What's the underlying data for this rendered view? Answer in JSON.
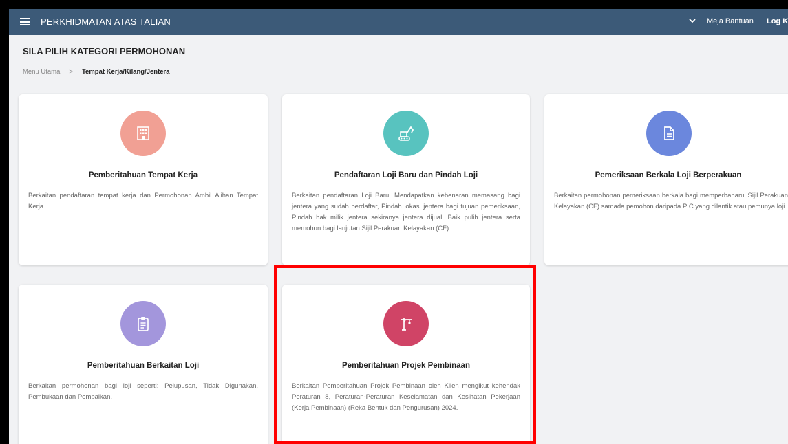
{
  "header": {
    "title": "PERKHIDMATAN ATAS TALIAN",
    "help_label": "Meja Bantuan",
    "logout_label": "Log Ke"
  },
  "page": {
    "title": "SILA PILIH KATEGORI PERMOHONAN",
    "breadcrumb": {
      "home": "Menu Utama",
      "separator": ">",
      "current": "Tempat Kerja/Kilang/Jentera"
    }
  },
  "cards": [
    {
      "title": "Pemberitahuan Tempat Kerja",
      "description": "Berkaitan pendaftaran tempat kerja dan Permohonan Ambil Alihan Tempat Kerja",
      "icon": "building-icon",
      "color": "#f1a094"
    },
    {
      "title": "Pendaftaran Loji Baru dan Pindah Loji",
      "description": "Berkaitan pendaftaran Loji Baru, Mendapatkan kebenaran memasang bagi jentera yang sudah berdaftar, Pindah lokasi jentera bagi tujuan pemeriksaan, Pindah hak milik jentera sekiranya jentera dijual, Baik pulih jentera serta memohon bagi lanjutan Sijil Perakuan Kelayakan (CF)",
      "icon": "excavator-icon",
      "color": "#58c3bf"
    },
    {
      "title": "Pemeriksaan Berkala Loji Berperakuan",
      "description": "Berkaitan permohonan pemeriksaan berkala bagi memperbaharui Sijil Perakuan Kelayakan (CF) samada pemohon daripada PIC yang dilantik atau pemunya loji",
      "icon": "document-icon",
      "color": "#6b87dd"
    },
    {
      "title": "Pemberitahuan Berkaitan Loji",
      "description": "Berkaitan permohonan bagi loji seperti: Pelupusan, Tidak Digunakan, Pembukaan dan Pembaikan.",
      "icon": "clipboard-icon",
      "color": "#a396dc"
    },
    {
      "title": "Pemberitahuan Projek Pembinaan",
      "description": "Berkaitan Pemberitahuan Projek Pembinaan oleh Klien mengikut kehendak Peraturan 8, Peraturan-Peraturan Keselamatan dan Kesihatan Pekerjaan (Kerja Pembinaan) (Reka Bentuk dan Pengurusan) 2024.",
      "icon": "crane-icon",
      "color": "#d04466"
    }
  ],
  "highlight_color": "#ff0000"
}
